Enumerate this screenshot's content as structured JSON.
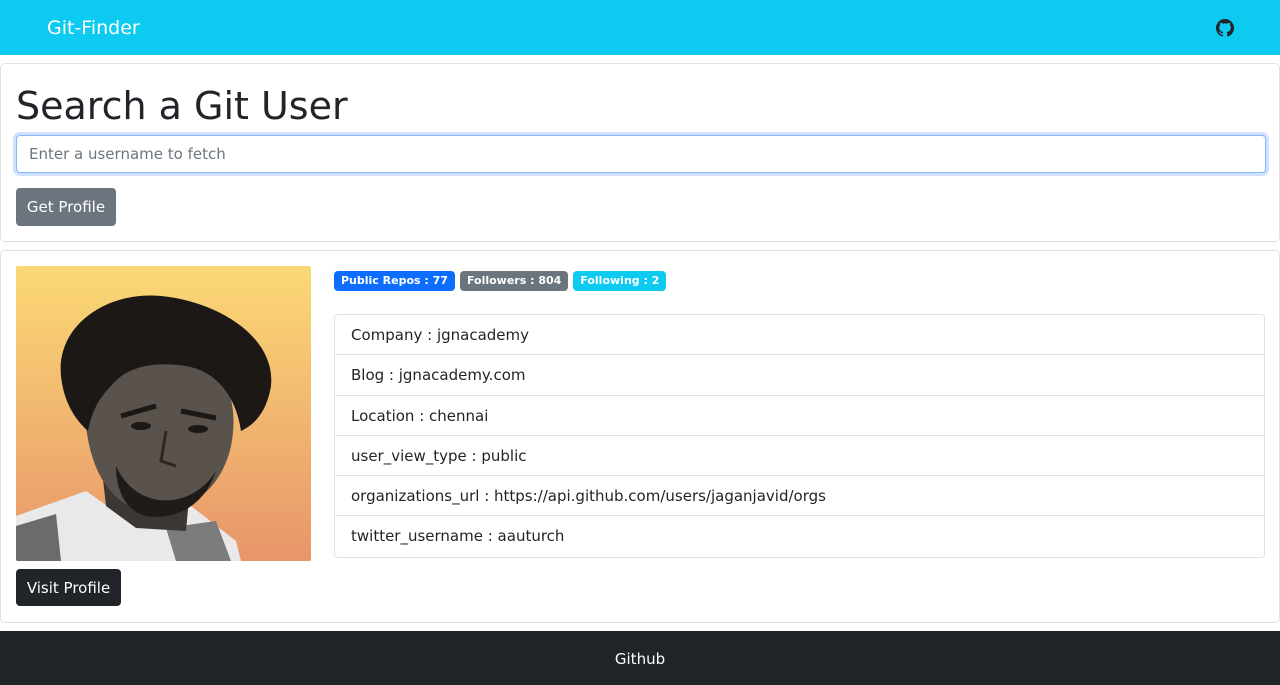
{
  "navbar": {
    "brand": "Git-Finder",
    "github_icon": "github-icon",
    "background": "#0dcaf0"
  },
  "search": {
    "title": "Search a Git User",
    "placeholder": "Enter a username to fetch",
    "value": "",
    "button_label": "Get Profile"
  },
  "profile": {
    "avatar_icon": "user-avatar-photo",
    "visit_label": "Visit Profile",
    "badges": [
      {
        "text": "Public Repos : 77",
        "color": "#0d6efd"
      },
      {
        "text": "Followers : 804",
        "color": "#6c757d"
      },
      {
        "text": "Following : 2",
        "color": "#0dcaf0"
      }
    ],
    "details": [
      "Company : jgnacademy",
      "Blog : jgnacademy.com",
      "Location : chennai",
      "user_view_type : public",
      "organizations_url : https://api.github.com/users/jaganjavid/orgs",
      "twitter_username : aauturch"
    ]
  },
  "footer": {
    "text": "Github",
    "background": "#212529"
  }
}
